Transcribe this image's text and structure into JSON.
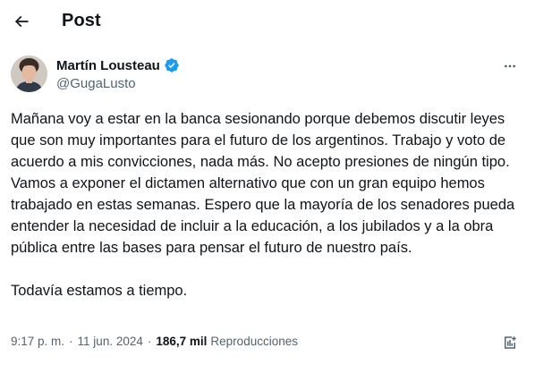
{
  "header": {
    "title": "Post",
    "back_icon": "arrow-left-icon"
  },
  "author": {
    "display_name": "Martín Lousteau",
    "handle": "@GugaLusto",
    "verified": true,
    "verified_color": "#1d9bf0",
    "avatar_icon": "profile-photo"
  },
  "tweet": {
    "paragraphs": [
      "Mañana voy a estar en la banca sesionando porque debemos discutir leyes que son muy importantes para el futuro de los argentinos. Trabajo y voto de acuerdo a mis convicciones, nada más. No acepto presiones de ningún tipo. Vamos a exponer el dictamen alternativo que con un gran equipo hemos trabajado en estas semanas. Espero que la mayoría de los senadores pueda entender la necesidad de incluir a la educación, a los jubilados y a la obra pública entre las bases para pensar el futuro de nuestro país.",
      "Todavía estamos a tiempo."
    ]
  },
  "meta": {
    "time": "9:17 p. m.",
    "separator": "·",
    "date": "11 jun. 2024",
    "views_count": "186,7 mil",
    "views_label": "Reproducciones"
  },
  "actions": {
    "more_icon": "more-icon",
    "analytics_icon": "analytics-icon"
  },
  "colors": {
    "text": "#0f1419",
    "secondary": "#536471",
    "accent": "#1d9bf0",
    "background": "#ffffff"
  }
}
